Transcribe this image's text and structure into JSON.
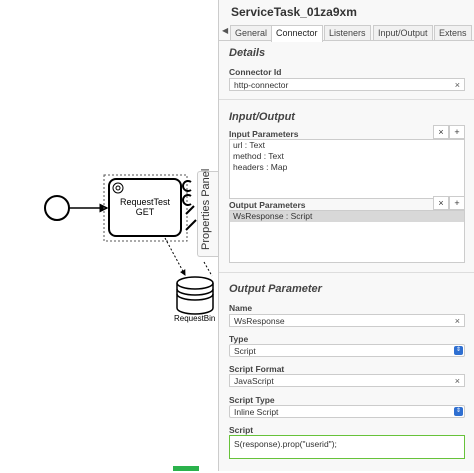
{
  "diagram": {
    "task_label_line1": "RequestTest",
    "task_label_line2": "GET",
    "datastore_label": "RequestBin",
    "panel_toggle_label": "Properties Panel"
  },
  "panel": {
    "title": "ServiceTask_01za9xm",
    "tabs": [
      {
        "label": "General"
      },
      {
        "label": "Connector"
      },
      {
        "label": "Listeners"
      },
      {
        "label": "Input/Output"
      },
      {
        "label": "Extens"
      }
    ],
    "active_tab": "Connector",
    "details": {
      "header": "Details",
      "connector_id_label": "Connector Id",
      "connector_id_value": "http-connector"
    },
    "input_output": {
      "header": "Input/Output",
      "input_params_label": "Input Parameters",
      "input_params": [
        "url : Text",
        "method : Text",
        "headers : Map"
      ],
      "output_params_label": "Output Parameters",
      "output_params": [
        "WsResponse : Script"
      ]
    },
    "output_parameter": {
      "header": "Output Parameter",
      "name_label": "Name",
      "name_value": "WsResponse",
      "type_label": "Type",
      "type_value": "Script",
      "script_format_label": "Script Format",
      "script_format_value": "JavaScript",
      "script_type_label": "Script Type",
      "script_type_value": "Inline Script",
      "script_label": "Script",
      "script_value": "S(response).prop(\"userid\");"
    },
    "buttons": {
      "remove": "×",
      "add": "+",
      "clear": "×"
    }
  },
  "colors": {
    "accent_blue": "#2f6fd1",
    "valid_green": "#67c23a",
    "panel_bg": "#f8f8f8"
  }
}
